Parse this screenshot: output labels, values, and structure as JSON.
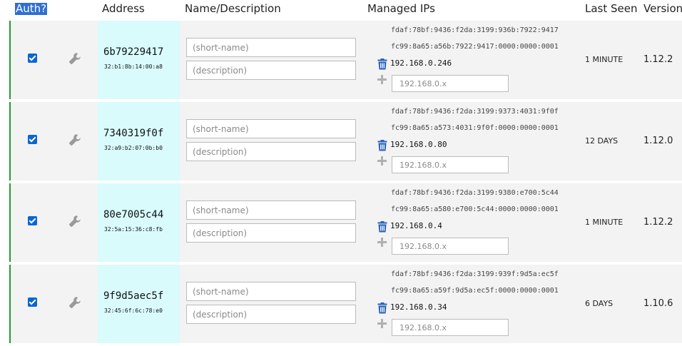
{
  "header": {
    "auth": "Auth?",
    "address": "Address",
    "name_description": "Name/Description",
    "managed_ips": "Managed IPs",
    "last_seen": "Last Seen",
    "version": "Version"
  },
  "placeholders": {
    "short_name": "(short-name)",
    "description": "(description)",
    "ip": "192.168.0.x"
  },
  "colors": {
    "authorized_border": "#1f9e2c",
    "address_bg": "#d9fbfc",
    "checkbox": "#0a66d6",
    "trash": "#2a62b8"
  },
  "members": [
    {
      "authorized": true,
      "id": "6b79229417",
      "mac": "32:b1:8b:14:00:a8",
      "ipv6": [
        "fdaf:78bf:9436:f2da:3199:936b:7922:9417",
        "fc99:8a65:a56b:7922:9417:0000:0000:0001"
      ],
      "ipv4": "192.168.0.246",
      "last_seen": "1 MINUTE",
      "version": "1.12.2"
    },
    {
      "authorized": true,
      "id": "7340319f0f",
      "mac": "32:a9:b2:07:0b:b0",
      "ipv6": [
        "fdaf:78bf:9436:f2da:3199:9373:4031:9f0f",
        "fc99:8a65:a573:4031:9f0f:0000:0000:0001"
      ],
      "ipv4": "192.168.0.80",
      "last_seen": "12 DAYS",
      "version": "1.12.0"
    },
    {
      "authorized": true,
      "id": "80e7005c44",
      "mac": "32:5a:15:36:c8:fb",
      "ipv6": [
        "fdaf:78bf:9436:f2da:3199:9380:e700:5c44",
        "fc99:8a65:a580:e700:5c44:0000:0000:0001"
      ],
      "ipv4": "192.168.0.4",
      "last_seen": "1 MINUTE",
      "version": "1.12.2"
    },
    {
      "authorized": true,
      "id": "9f9d5aec5f",
      "mac": "32:45:6f:6c:78:e0",
      "ipv6": [
        "fdaf:78bf:9436:f2da:3199:939f:9d5a:ec5f",
        "fc99:8a65:a59f:9d5a:ec5f:0000:0000:0001"
      ],
      "ipv4": "192.168.0.34",
      "last_seen": "6 DAYS",
      "version": "1.10.6"
    }
  ]
}
